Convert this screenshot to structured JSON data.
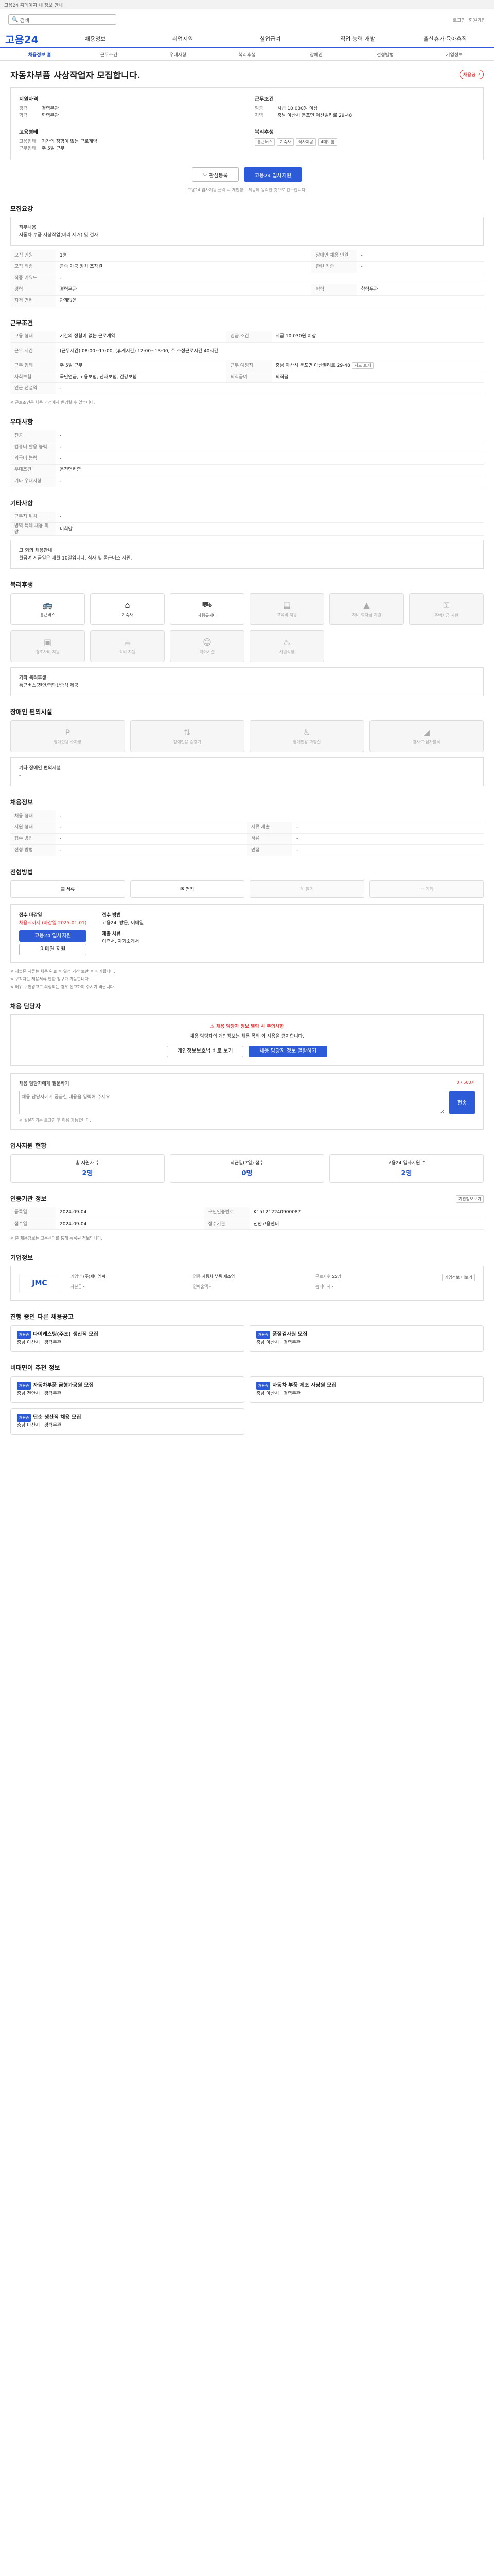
{
  "topbar": {
    "text": "고용24 홈페이지 내 정보 안내"
  },
  "search": {
    "placeholder": "검색",
    "links": [
      "로그인",
      "회원가입"
    ]
  },
  "gnb": {
    "logo": "고용24",
    "items": [
      "채용정보",
      "취업지원",
      "실업급여",
      "직업 능력 개발",
      "출산휴가·육아휴직"
    ]
  },
  "subnav": {
    "items": [
      "채용정보 홈",
      "근무조건",
      "우대사항",
      "복리후생",
      "장애인",
      "전형방법",
      "기업정보"
    ],
    "active": 0
  },
  "job": {
    "title": "자동차부품 사상작업자 모집합니다.",
    "badge": "채용공고",
    "summary": {
      "col1_h": "지원자격",
      "col1_rows": [
        {
          "k": "경력",
          "v": "경력무관"
        },
        {
          "k": "학력",
          "v": "학력무관"
        }
      ],
      "col2_h": "근무조건",
      "col2_rows": [
        {
          "k": "임금",
          "v": "시급 10,030원 이상"
        },
        {
          "k": "지역",
          "v": "충남 아산시 둔포면 아산밸리로 29-48"
        }
      ],
      "col3_h": "고용형태",
      "col3_rows": [
        {
          "k": "고용형태",
          "v": "기간의 정함이 없는 근로계약"
        },
        {
          "k": "근무형태",
          "v": "주 5일 근무"
        }
      ],
      "col4_h": "복리후생",
      "col4_tags": [
        "통근버스",
        "기숙사",
        "식사제공",
        "4대보험"
      ]
    },
    "buttons": {
      "save": "관심등록",
      "apply": "고용24 입사지원"
    },
    "note": "고용24 입사지원 클릭 시 개인정보 제공에 동의한 것으로 간주합니다."
  },
  "recruit": {
    "title": "모집요강",
    "duty_h": "직무내용",
    "duty": "자동차 부품 사상작업(바리 제거) 및 검사",
    "rows": [
      {
        "k": "모집 인원",
        "v": "1명",
        "k2": "장애인 채용 인원",
        "v2": "-"
      },
      {
        "k": "모집 직종",
        "v": "금속 가공 장치 조작원",
        "k2": "관련 직종",
        "v2": "-"
      },
      {
        "k": "직종 키워드",
        "v": "-",
        "k2": "",
        "v2": ""
      },
      {
        "k": "경력",
        "v": "경력무관",
        "k2": "학력",
        "v2": "학력무관"
      },
      {
        "k": "자격 면허",
        "v": "관계없음",
        "k2": "",
        "v2": ""
      }
    ]
  },
  "conditions": {
    "title": "근무조건",
    "rows": [
      {
        "k": "고용 형태",
        "v": "기간의 정함이 없는 근로계약",
        "k2": "임금 조건",
        "v2": "시급 10,030원 이상"
      },
      {
        "k": "근무 시간",
        "v": "(근무시간) 08:00~17:00, (휴게시간) 12:00~13:00, 주 소정근로시간 40시간",
        "k2": "",
        "v2": ""
      },
      {
        "k": "근무 형태",
        "v": "주 5일 근무",
        "k2": "근무 예정지",
        "v2": "충남 아산시 둔포면 아산밸리로 29-48"
      },
      {
        "k": "사회보험",
        "v": "국민연금, 고용보험, 산재보험, 건강보험",
        "k2": "퇴직급여",
        "v2": "퇴직금"
      },
      {
        "k": "인근 전철역",
        "v": "-",
        "k2": "",
        "v2": ""
      }
    ],
    "map_button": "지도 보기",
    "note": "※ 근로조건은 채용 과정에서 변경될 수 있습니다."
  },
  "prefer": {
    "title": "우대사항",
    "rows": [
      {
        "k": "전공",
        "v": "-"
      },
      {
        "k": "컴퓨터 활용 능력",
        "v": "-"
      },
      {
        "k": "외국어 능력",
        "v": "-"
      },
      {
        "k": "우대조건",
        "v": "운전면허증"
      },
      {
        "k": "기타 우대사항",
        "v": "-"
      }
    ]
  },
  "etc": {
    "title": "기타사항",
    "rows": [
      {
        "k": "근무지 위치",
        "v": "-"
      },
      {
        "k": "병역 특례 채용 희망",
        "v": "비희망"
      }
    ],
    "box_h": "그 외의 채용안내",
    "box": "월급여 지급일은 매월 10일입니다. 식사 및 통근버스 지원."
  },
  "welfare": {
    "title": "복리후생",
    "items": [
      {
        "label": "통근버스",
        "icon": "bus-icon",
        "on": true
      },
      {
        "label": "기숙사",
        "icon": "house-icon",
        "on": true
      },
      {
        "label": "차량유지비",
        "icon": "car-icon",
        "on": true
      },
      {
        "label": "교육비 지원",
        "icon": "book-icon",
        "on": false
      },
      {
        "label": "자녀 학자금 지원",
        "icon": "cap-icon",
        "on": false
      },
      {
        "label": "주택자금 지원",
        "icon": "key-icon",
        "on": false
      },
      {
        "label": "경조사비 지원",
        "icon": "gift-icon",
        "on": false
      },
      {
        "label": "식비 지원",
        "icon": "food-icon",
        "on": false
      },
      {
        "label": "탁아시설",
        "icon": "baby-icon",
        "on": false
      },
      {
        "label": "사원식당",
        "icon": "spoon-icon",
        "on": false
      }
    ],
    "etc_h": "기타 복리후생",
    "etc": "통근버스(천안/평택)/중식 제공"
  },
  "disabled": {
    "title": "장애인 편의시설",
    "items": [
      {
        "label": "장애인용 주차장",
        "icon": "parking-icon"
      },
      {
        "label": "장애인용 승강기",
        "icon": "elevator-icon"
      },
      {
        "label": "장애인용 화장실",
        "icon": "toilet-icon"
      },
      {
        "label": "경사로·점자블록",
        "icon": "ramp-icon"
      }
    ],
    "etc_h": "기타 장애인 편의시설",
    "etc": "-"
  },
  "info": {
    "title": "채용정보",
    "rows": [
      {
        "k": "채용 형태",
        "v": "-",
        "k2": "",
        "v2": ""
      },
      {
        "k": "지원 형태",
        "v": "-",
        "k2": "서류 제출",
        "v2": "-"
      },
      {
        "k": "접수 방법",
        "v": "-",
        "k2": "서류",
        "v2": "-"
      },
      {
        "k": "전형 방법",
        "v": "-",
        "k2": "면접",
        "v2": "-"
      }
    ]
  },
  "apply": {
    "title": "전형방법",
    "methods": [
      {
        "label": "서류",
        "icon": "doc-icon",
        "on": true
      },
      {
        "label": "면접",
        "icon": "talk-icon",
        "on": true
      },
      {
        "label": "필기",
        "icon": "pen-icon",
        "on": false
      },
      {
        "label": "기타",
        "icon": "etc-icon",
        "on": false
      }
    ],
    "left_h": "접수 마감일",
    "left_v": "채용시까지 (마감일 2025-01-01)",
    "left_btn": "고용24 입사지원",
    "left_btn2": "이메일 지원",
    "right_h": "접수 방법",
    "right_v": "고용24, 방문, 이메일",
    "right_h2": "제출 서류",
    "right_v2": "이력서, 자기소개서",
    "notes": [
      "※ 제출된 서류는 채용 완료 후 일정 기간 보관 후 파기됩니다.",
      "※ 구직자는 채용서류 반환 청구가 가능합니다.",
      "※ 허위 구인광고로 의심되는 경우 신고하여 주시기 바랍니다."
    ]
  },
  "contact": {
    "title": "채용 담당자",
    "warn": "채용 담당자 정보 열람 시 주의사항",
    "text": "채용 담당자의 개인정보는 채용 목적 외 사용을 금지합니다.",
    "btn1": "개인정보보호법 바로 보기",
    "btn2": "채용 담당자 정보 열람하기"
  },
  "question": {
    "title": "채용 담당자에게 질문하기",
    "placeholder": "채용 담당자에게 궁금한 내용을 입력해 주세요.",
    "count": "0 / 500자",
    "submit": "전송",
    "note": "※ 질문하기는 로그인 후 이용 가능합니다."
  },
  "stats": {
    "title": "입사지원 현황",
    "cards": [
      {
        "label": "총 지원자 수",
        "value": "2명"
      },
      {
        "label": "최근일(7일) 접수",
        "value": "0명"
      },
      {
        "label": "고용24 입사지원 수",
        "value": "2명"
      }
    ]
  },
  "org": {
    "title": "인증기관 정보",
    "rows": [
      {
        "k": "등록일",
        "v": "2024-09-04",
        "k2": "구인인증번호",
        "v2": "K151212240900087"
      },
      {
        "k": "접수일",
        "v": "2024-09-04",
        "k2": "접수기관",
        "v2": "천안고용센터"
      }
    ],
    "btn": "기관정보보기",
    "note": "※ 본 채용정보는 고용센터를 통해 등록된 정보입니다."
  },
  "company": {
    "title": "기업정보",
    "logo": "JMC",
    "rows": [
      {
        "k": "기업명",
        "v": "(주)제이엠씨"
      },
      {
        "k": "업종",
        "v": "자동차 부품 제조업"
      },
      {
        "k": "근로자수",
        "v": "55명"
      },
      {
        "k": "자본금",
        "v": "-"
      },
      {
        "k": "연매출액",
        "v": "-"
      },
      {
        "k": "홈페이지",
        "v": "-"
      }
    ],
    "btn": "기업정보 더보기"
  },
  "similar": {
    "title": "진행 중인 다른 채용공고",
    "items": [
      {
        "badge": "채용중",
        "title": "다이캐스팅(주조) 생산직 모집",
        "sub": "충남 아산시 · 경력무관"
      },
      {
        "badge": "채용중",
        "title": "품질검사원 모집",
        "sub": "충남 아산시 · 경력무관"
      }
    ]
  },
  "recommend": {
    "title": "비대면이 추천 정보",
    "items": [
      {
        "badge": "채용중",
        "title": "자동차부품 금형가공원 모집",
        "sub": "충남 천안시 · 경력무관"
      },
      {
        "badge": "채용중",
        "title": "자동차 부품 제조 사상원 모집",
        "sub": "충남 아산시 · 경력무관"
      },
      {
        "badge": "채용중",
        "title": "단순 생산직 채용 모집",
        "sub": "충남 아산시 · 경력무관"
      }
    ]
  }
}
